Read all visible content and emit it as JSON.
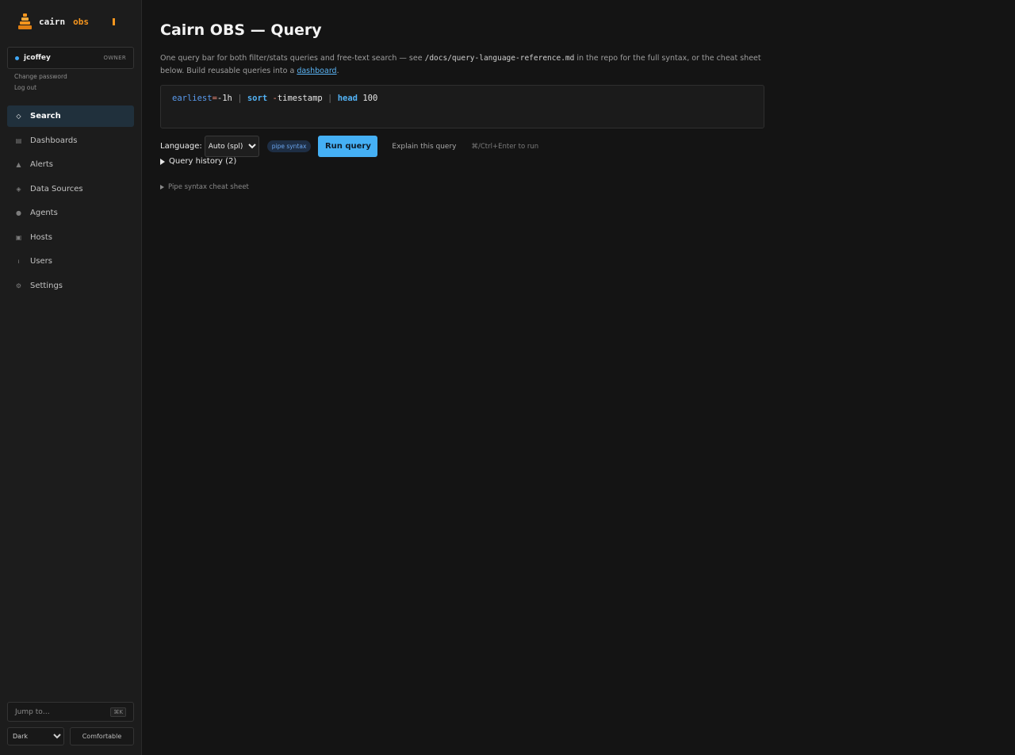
{
  "brand": {
    "name": "cairn",
    "suffix": "obs"
  },
  "user": {
    "name": "jcoffey",
    "role": "OWNER",
    "change_password": "Change password",
    "logout": "Log out"
  },
  "nav": {
    "items": [
      {
        "label": "Search",
        "icon": "diamond-icon",
        "glyph": "◇",
        "active": true
      },
      {
        "label": "Dashboards",
        "icon": "dashboard-icon",
        "glyph": "▤"
      },
      {
        "label": "Alerts",
        "icon": "alert-icon",
        "glyph": "▲"
      },
      {
        "label": "Data Sources",
        "icon": "data-sources-icon",
        "glyph": "◈"
      },
      {
        "label": "Agents",
        "icon": "agent-icon",
        "glyph": "●"
      },
      {
        "label": "Hosts",
        "icon": "host-icon",
        "glyph": "▣"
      },
      {
        "label": "Users",
        "icon": "user-icon",
        "glyph": "ı"
      },
      {
        "label": "Settings",
        "icon": "gear-icon",
        "glyph": "⚙"
      }
    ]
  },
  "footer": {
    "jump_placeholder": "Jump to…",
    "jump_kbd": "⌘K",
    "theme_value": "Dark",
    "density_label": "Comfortable"
  },
  "main": {
    "title": "Cairn OBS — Query",
    "intro": {
      "before": "One query bar for both filter/stats queries and free-text search — see ",
      "code": "/docs/query-language-reference.md",
      "middle": " in the repo for the full syntax, or the cheat sheet below. Build reusable queries into a ",
      "link": "dashboard",
      "after": "."
    },
    "query": {
      "field": "earliest",
      "eq": "=",
      "range": "-1h",
      "pipe": "|",
      "cmd1": "sort",
      "minus": "-",
      "sort_field": "timestamp",
      "cmd2": "head",
      "limit": "100"
    },
    "controls": {
      "language_label": "Language:",
      "language_value": "Auto (spl)",
      "syntax_badge": "pipe syntax",
      "run_label": "Run query",
      "explain_label": "Explain this query",
      "hint": "⌘/Ctrl+Enter to run"
    },
    "history_label": "Query history (2)",
    "cheat_sheet_label": "Pipe syntax cheat sheet"
  },
  "colors": {
    "accent": "#45b0f5",
    "brand_orange": "#f7961e",
    "background": "#141414",
    "sidebar": "#1c1c1c"
  }
}
